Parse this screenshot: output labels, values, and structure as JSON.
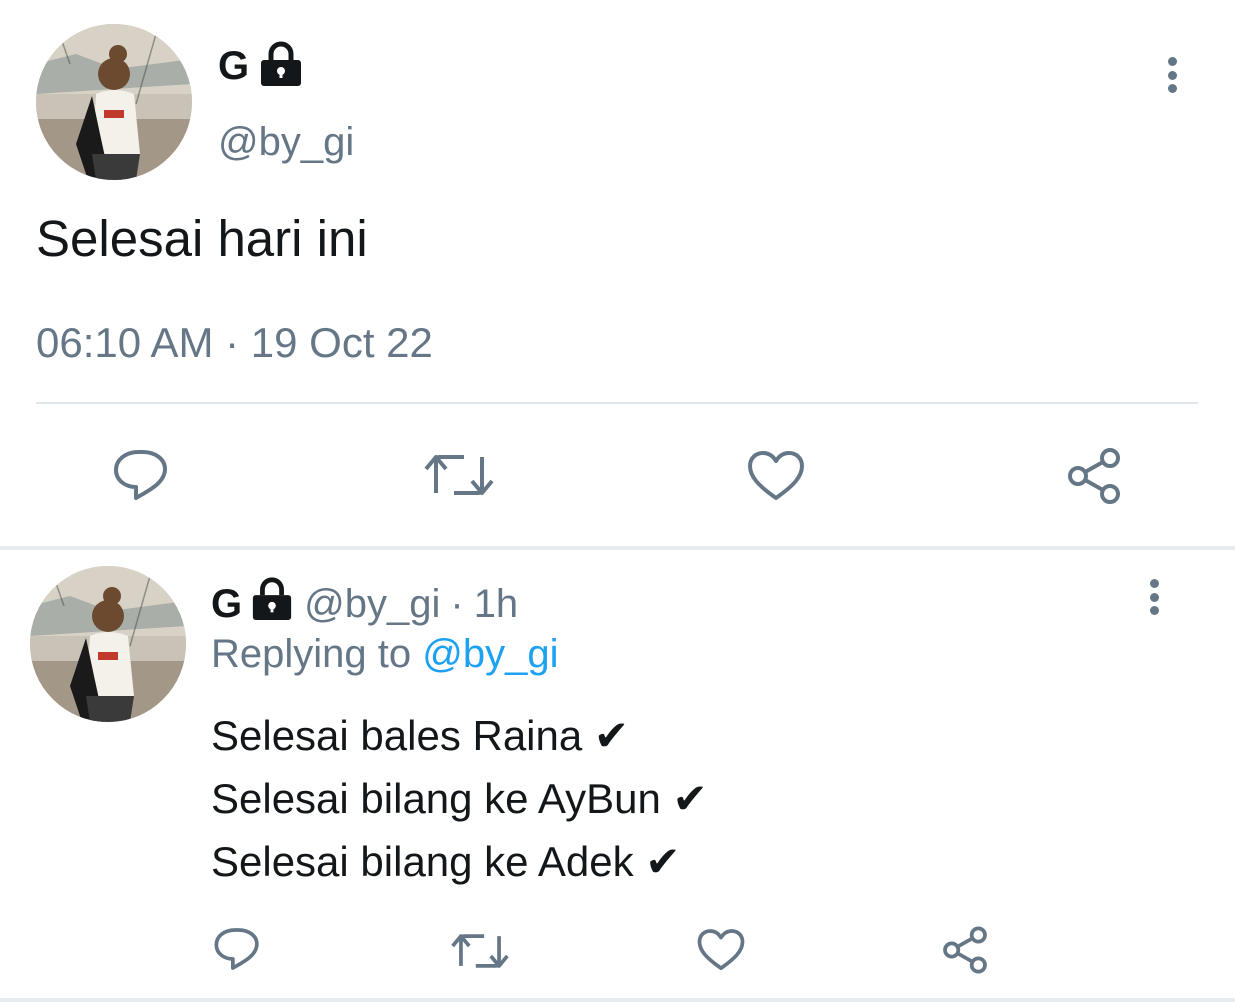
{
  "main_tweet": {
    "display_name": "G",
    "handle": "@by_gi",
    "text": "Selesai hari ini",
    "timestamp": "06:10 AM · 19 Oct 22",
    "icons": {
      "verified_lock": "lock-icon",
      "more": "more-vertical-icon",
      "reply": "reply-icon",
      "retweet": "retweet-icon",
      "like": "heart-icon",
      "share": "share-icon"
    }
  },
  "reply_tweet": {
    "display_name": "G",
    "handle": "@by_gi",
    "separator": "·",
    "time_ago": "1h",
    "replying_prefix": "Replying to",
    "replying_to": "@by_gi",
    "lines": [
      "Selesai bales Raina ✔",
      "Selesai bilang ke AyBun ✔",
      "Selesai bilang ke Adek ✔"
    ]
  },
  "colors": {
    "text_primary": "#14171a",
    "text_secondary": "#657786",
    "link": "#1da1f2",
    "divider": "#e1e8ed",
    "background": "#ffffff"
  }
}
